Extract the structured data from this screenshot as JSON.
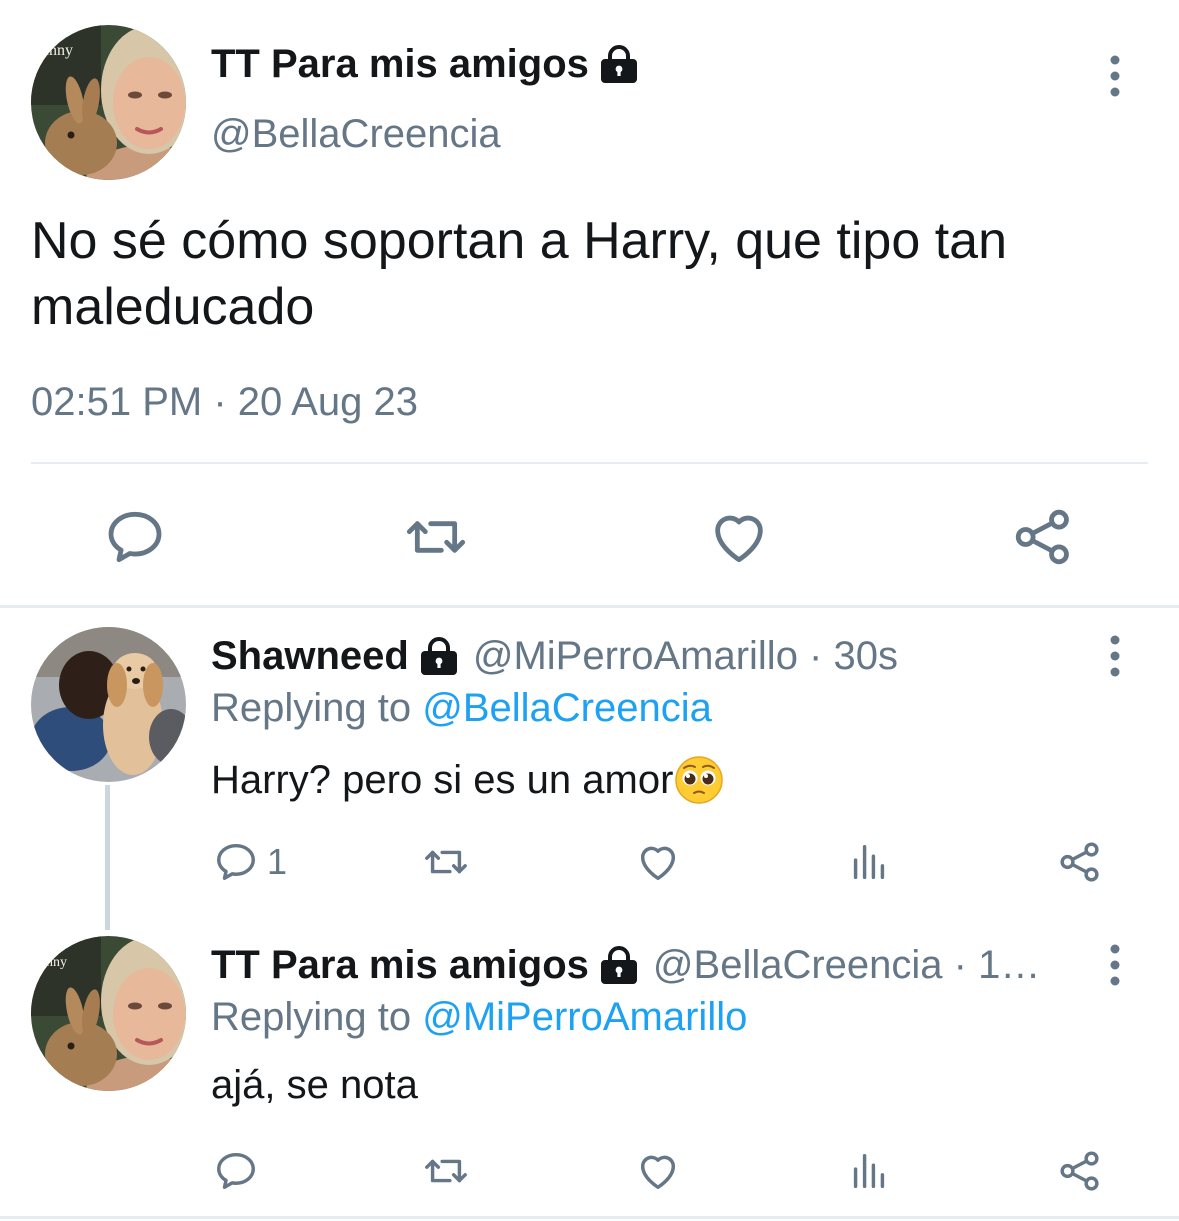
{
  "main_tweet": {
    "display_name": "TT Para mis amigos",
    "lock_icon": "lock-icon",
    "handle": "@BellaCreencia",
    "text": "No sé cómo soportan a Harry, que tipo tan maleducado",
    "timestamp": "02:51 PM · 20 Aug 23",
    "avatar_caption": "unny",
    "actions": [
      "reply-icon",
      "retweet-icon",
      "like-icon",
      "share-icon"
    ]
  },
  "replies": [
    {
      "display_name": "Shawneed",
      "handle_time": "@MiPerroAmarillo · 30s",
      "replying_prefix": "Replying to ",
      "replying_mention": "@BellaCreencia",
      "text": "Harry? pero si es un amor",
      "emoji": "pleading-face-emoji",
      "reply_count": "1"
    },
    {
      "display_name": "TT Para mis amigos",
      "handle_time": "@BellaCreencia · 1…",
      "replying_prefix": "Replying to ",
      "replying_mention": "@MiPerroAmarillo",
      "text": "ajá, se nota",
      "avatar_caption": "unny",
      "reply_count": ""
    }
  ],
  "colors": {
    "text": "#14171a",
    "secondary": "#657786",
    "link": "#1da1f2",
    "divider": "#e6ecf0",
    "icon": "#657786"
  }
}
